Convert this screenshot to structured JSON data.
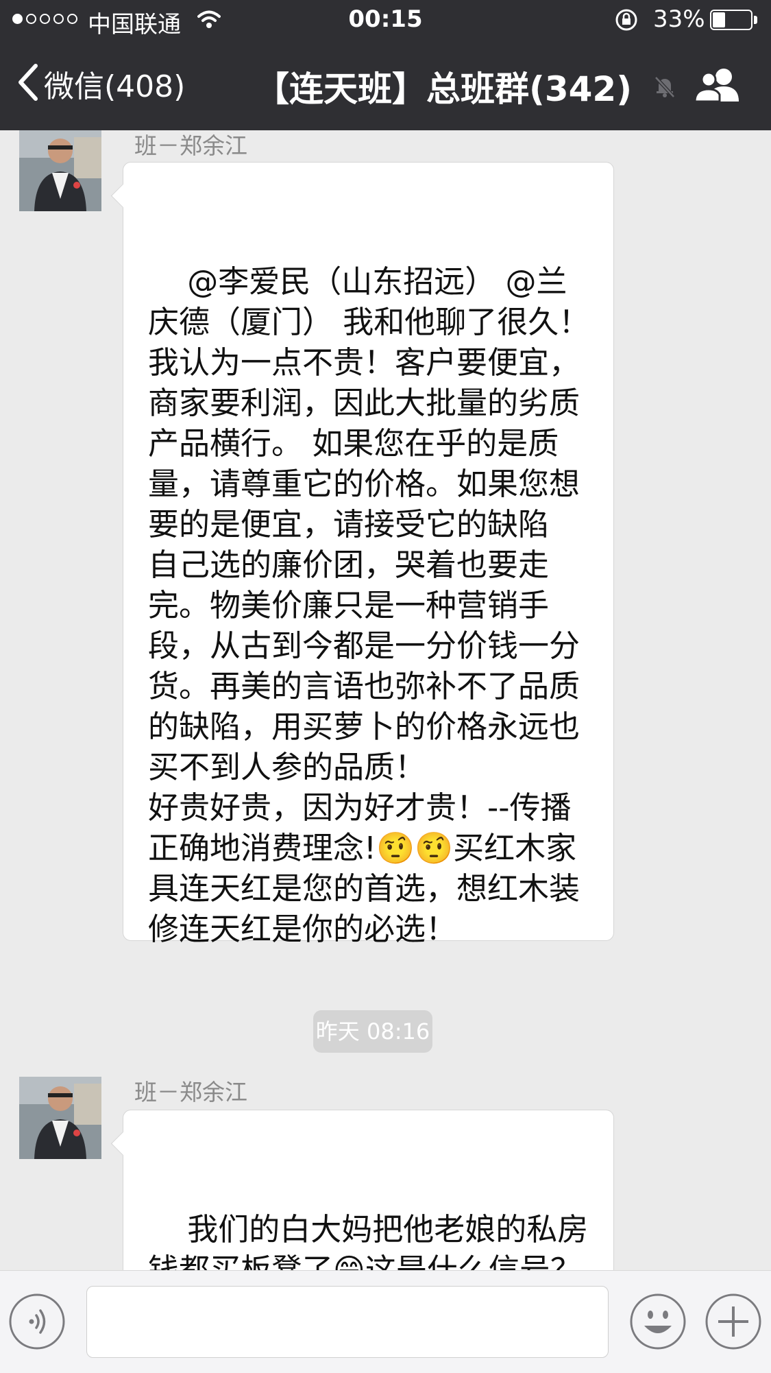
{
  "status_bar": {
    "carrier": "中国联通",
    "time": "00:15",
    "battery_percent": "33%",
    "battery_level": 0.33,
    "signal_bars": 1,
    "signal_total": 5
  },
  "nav": {
    "back_label": "微信(408)",
    "title": "【连天班】总班群(342)",
    "icons": [
      "chevron-left-icon",
      "mute-bell-icon",
      "group-members-icon"
    ]
  },
  "messages": [
    {
      "sender": "班－郑余江",
      "text": "@李爱民（山东招远） @兰庆德（厦门） 我和他聊了很久！我认为一点不贵！客户要便宜，商家要利润，因此大批量的劣质产品横行。 如果您在乎的是质量，请尊重它的价格。如果您想要的是便宜，请接受它的缺陷  自己选的廉价团，哭着也要走完。物美价廉只是一种营销手段，从古到今都是一分价钱一分货。再美的言语也弥补不了品质的缺陷，用买萝卜的价格永远也买不到人参的品质！\n好贵好贵，因为好才贵！--传播正确地消费理念!🤨🤨买红木家具连天红是您的首选，想红木装修连天红是你的必选！"
    },
    {
      "sender": "班－郑余江",
      "text": "我们的白大妈把他老娘的私房钱都买板凳了😁这是什么信号？难道有什么内幕消息😁🤔\n🤔"
    }
  ],
  "timestamp": "昨天 08:16",
  "input_bar": {
    "icons": [
      "voice-icon",
      "emoji-icon",
      "plus-icon"
    ],
    "input_value": ""
  },
  "colors": {
    "nav_background": "#2f2f33",
    "chat_background": "#ebebeb",
    "bubble_background": "#ffffff",
    "timestamp_background": "#d4d4d4"
  }
}
